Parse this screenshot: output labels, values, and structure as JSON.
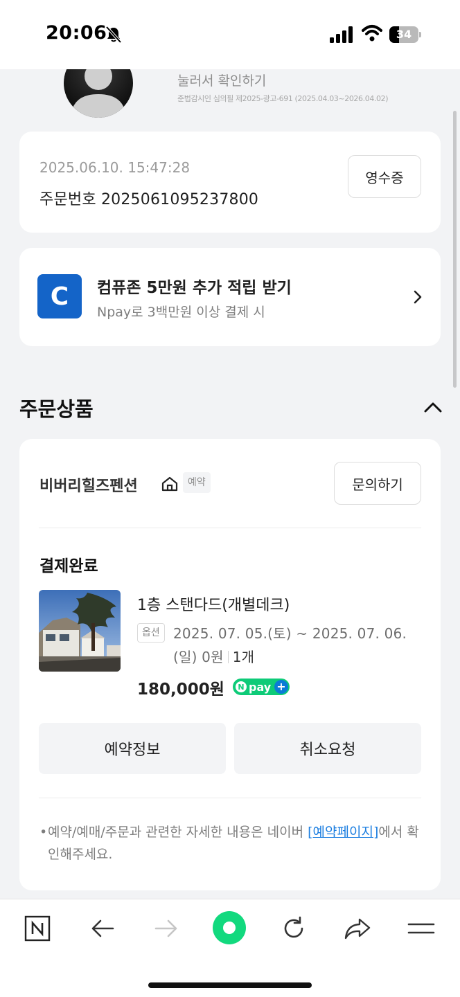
{
  "status_bar": {
    "time": "20:06",
    "battery_level": "34",
    "icons": [
      "bell-slash-icon",
      "cellular-signal-icon",
      "wifi-icon",
      "battery-icon"
    ]
  },
  "profile_ad": {
    "title": "눌러서 확인하기",
    "note": "준법감시인 심의필 제2025-광고-691 (2025.04.03~2026.04.02)"
  },
  "order": {
    "datetime": "2025.06.10. 15:47:28",
    "number_label": "주문번호 2025061095237800",
    "receipt_button": "영수증"
  },
  "promo": {
    "logo_letter": "C",
    "title": "컴퓨존 5만원 추가 적립 받기",
    "subtitle": "Npay로 3백만원 이상 결제 시",
    "brand_color": "#1464C8"
  },
  "section": {
    "title": "주문상품",
    "expanded": true
  },
  "product": {
    "shop_name": "비버리힐즈펜션",
    "tag": "예약",
    "inquiry_button": "문의하기",
    "status": "결제완료",
    "name": "1층 스탠다드(개별데크)",
    "option_badge": "옵션",
    "option_text": "2025. 07. 05.(토) ~ 2025. 07. 06.(일) 0원",
    "quantity": "1개",
    "price": "180,000원",
    "pay_badge_text": "pay",
    "pay_badge_n": "N",
    "pay_badge_plus": "+",
    "pay_color": "#0ECB78"
  },
  "actions": {
    "reserve_info": "예약정보",
    "cancel_request": "취소요청"
  },
  "notice": {
    "bullet": "•",
    "before_link": "예약/예매/주문과 관련한 자세한 내용은 네이버 ",
    "link": "[예약페이지]",
    "after_link": "에서 확인해주세요."
  },
  "toolbar": {
    "items": [
      "naver-home-icon",
      "back-arrow-icon",
      "forward-arrow-icon",
      "green-dot-icon",
      "refresh-icon",
      "share-icon",
      "menu-icon"
    ],
    "forward_enabled": false
  }
}
